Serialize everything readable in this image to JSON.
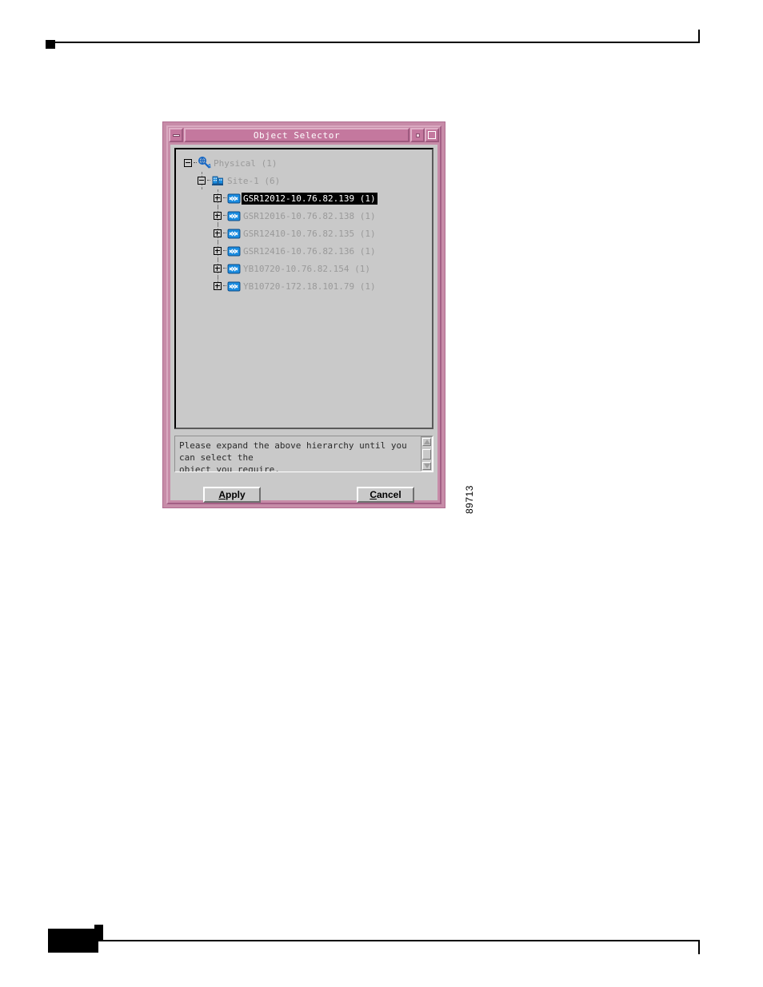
{
  "figure": {
    "id_label": "89713"
  },
  "window": {
    "title": "Object Selector",
    "controls": {
      "minimize": "minimize-button",
      "restore": "restore-button",
      "maximize": "maximize-button"
    }
  },
  "tree": {
    "nodes": [
      {
        "label": "Physical (1)",
        "level": 0,
        "expander": "minus",
        "icon": "network-globe-icon",
        "selected": false
      },
      {
        "label": "Site-1 (6)",
        "level": 1,
        "expander": "minus",
        "icon": "site-building-icon",
        "selected": false
      },
      {
        "label": "GSR12012-10.76.82.139 (1)",
        "level": 2,
        "expander": "plus",
        "icon": "router-icon",
        "selected": true
      },
      {
        "label": "GSR12016-10.76.82.138 (1)",
        "level": 2,
        "expander": "plus",
        "icon": "router-icon",
        "selected": false
      },
      {
        "label": "GSR12410-10.76.82.135 (1)",
        "level": 2,
        "expander": "plus",
        "icon": "router-icon",
        "selected": false
      },
      {
        "label": "GSR12416-10.76.82.136 (1)",
        "level": 2,
        "expander": "plus",
        "icon": "router-icon",
        "selected": false
      },
      {
        "label": "YB10720-10.76.82.154 (1)",
        "level": 2,
        "expander": "plus",
        "icon": "router-icon",
        "selected": false
      },
      {
        "label": "YB10720-172.18.101.79 (1)",
        "level": 2,
        "expander": "plus",
        "icon": "router-icon",
        "selected": false
      }
    ]
  },
  "message": {
    "line1": "Please expand the above hierarchy until you can select the",
    "line2": "object you require."
  },
  "buttons": {
    "apply": {
      "mnemonic": "A",
      "rest": "pply"
    },
    "cancel": {
      "mnemonic": "C",
      "rest": "ancel"
    }
  },
  "colors": {
    "titlebar": "#c4789e",
    "window_frame": "#c78ca8",
    "client": "#c9c9c9",
    "selection": "#000000",
    "tree_text": "#9a9a9a",
    "icon_blue": "#1a8ce0"
  }
}
